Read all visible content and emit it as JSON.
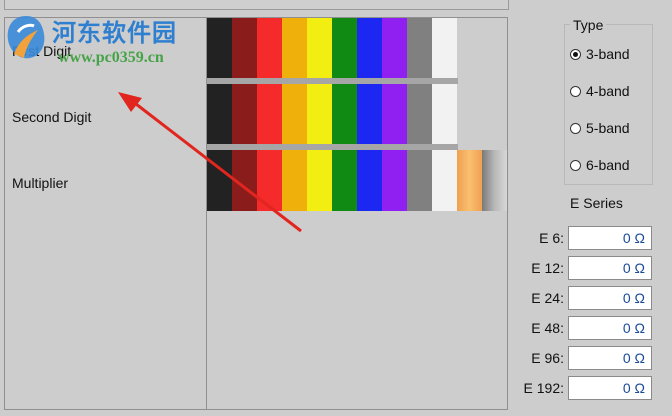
{
  "left": {
    "rows": [
      {
        "label": "First Digit"
      },
      {
        "label": "Second Digit"
      },
      {
        "label": "Multiplier"
      }
    ],
    "digit_colors": [
      "#222222",
      "#8b1c1c",
      "#f52a2a",
      "#f0b00c",
      "#f2ee12",
      "#108a12",
      "#1c28f2",
      "#9020f2",
      "#808080",
      "#f2f2f2"
    ],
    "multiplier_colors": [
      "#222222",
      "#8b1c1c",
      "#f52a2a",
      "#f0b00c",
      "#f2ee12",
      "#108a12",
      "#1c28f2",
      "#9020f2",
      "#808080",
      "#f2f2f2",
      "#f5a85a",
      "#9a9a9a"
    ]
  },
  "type": {
    "title": "Type",
    "options": [
      {
        "label": "3-band",
        "selected": true
      },
      {
        "label": "4-band",
        "selected": false
      },
      {
        "label": "5-band",
        "selected": false
      },
      {
        "label": "6-band",
        "selected": false
      }
    ]
  },
  "eseries": {
    "title": "E Series",
    "rows": [
      {
        "label": "E 6:",
        "value": "0 Ω"
      },
      {
        "label": "E 12:",
        "value": "0 Ω"
      },
      {
        "label": "E 24:",
        "value": "0 Ω"
      },
      {
        "label": "E 48:",
        "value": "0 Ω"
      },
      {
        "label": "E 96:",
        "value": "0 Ω"
      },
      {
        "label": "E 192:",
        "value": "0 Ω"
      }
    ]
  },
  "watermark": {
    "title": "河东软件园",
    "url": "www.pc0359.cn",
    "title_color": "#2f7fd0",
    "url_color": "#47a347"
  },
  "annotation": {
    "arrow_color": "#e0261e"
  }
}
